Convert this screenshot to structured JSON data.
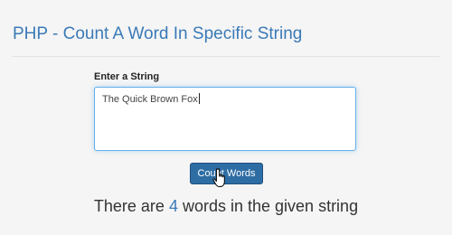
{
  "page": {
    "title": "PHP - Count A Word In Specific String"
  },
  "form": {
    "label": "Enter a String",
    "input_value": "The Quick Brown Fox",
    "button_label": "Count Words"
  },
  "result": {
    "prefix": "There are",
    "count": "4",
    "suffix": "words in the given string"
  },
  "colors": {
    "accent": "#3a7ab8",
    "button": "#2e6da4",
    "focus_border": "#66afe9"
  },
  "icons": {
    "cursor": "hand-pointer-icon"
  }
}
